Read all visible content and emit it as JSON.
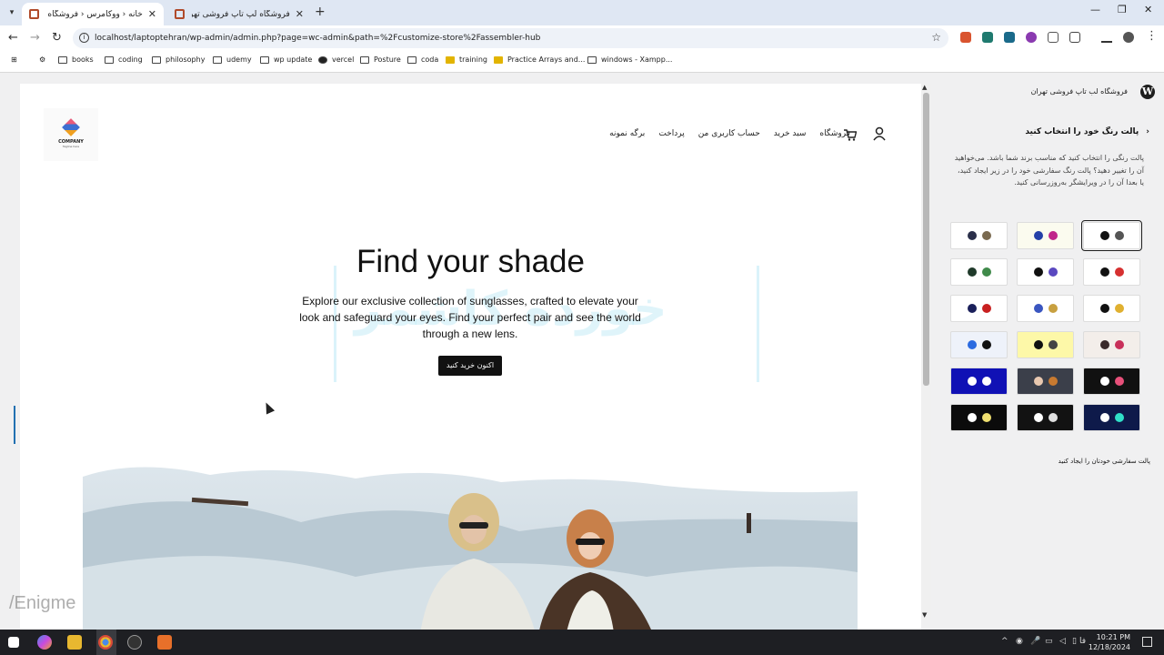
{
  "browser": {
    "tabs": [
      {
        "title": "خانه ‹ ووکامرس ‹ فروشگاه لب تاب",
        "active": true
      },
      {
        "title": "فروشگاه لپ تاپ فروشی تهران",
        "active": false
      }
    ],
    "url": "localhost/laptoptehran/wp-admin/admin.php?page=wc-admin&path=%2Fcustomize-store%2Fassembler-hub",
    "bookmarks": [
      "books",
      "coding",
      "philosophy",
      "udemy",
      "wp update",
      "vercel",
      "Posture",
      "coda",
      "training",
      "Practice Arrays and...",
      "windows - Xampp..."
    ]
  },
  "site": {
    "logo": {
      "name": "COMPANY",
      "tagline": "Tagline here"
    },
    "nav": [
      "فروشگاه",
      "سبد خرید",
      "حساب کاربری من",
      "پرداخت",
      "برگه نمونه"
    ],
    "hero": {
      "title": "Find your shade",
      "text": "Explore our exclusive collection of sunglasses, crafted to elevate your look and safeguard your eyes. Find your perfect pair and see the world through a new lens.",
      "button": "اکنون خرید کنید"
    },
    "watermark": "خورده کاشمر"
  },
  "sidebar": {
    "site_title": "فروشگاه لب تاپ فروشی تهران",
    "heading": "پالت رنگ خود را انتخاب کنید",
    "description": "پالت رنگی را انتخاب کنید که مناسب برند شما باشد. می‌خواهید آن را تغییر دهید؟ پالت رنگ سفارشی خود را در زیر ایجاد کنید، یا بعدا آن را در ویرایشگر به‌روزرسانی کنید.",
    "custom_link": "پالت سفارشی خودتان را ایجاد کنید",
    "palettes": [
      {
        "bg": "#ffffff",
        "dots": [
          "#2a2f4a",
          "#7a6a50"
        ],
        "selected": false
      },
      {
        "bg": "#fbfbef",
        "dots": [
          "#2440a8",
          "#c0258a"
        ],
        "selected": false
      },
      {
        "bg": "#ffffff",
        "dots": [
          "#111111",
          "#555555"
        ],
        "selected": true
      },
      {
        "bg": "#ffffff",
        "dots": [
          "#1f3a2a",
          "#3f8a4a"
        ],
        "selected": false
      },
      {
        "bg": "#ffffff",
        "dots": [
          "#111111",
          "#5a48c0"
        ],
        "selected": false
      },
      {
        "bg": "#ffffff",
        "dots": [
          "#111111",
          "#d63030"
        ],
        "selected": false
      },
      {
        "bg": "#ffffff",
        "dots": [
          "#1a1f5a",
          "#c82020"
        ],
        "selected": false
      },
      {
        "bg": "#ffffff",
        "dots": [
          "#3a56c0",
          "#c8a040"
        ],
        "selected": false
      },
      {
        "bg": "#ffffff",
        "dots": [
          "#111111",
          "#e0b030"
        ],
        "selected": false
      },
      {
        "bg": "#eef2fa",
        "dots": [
          "#2a6ae0",
          "#111111"
        ],
        "selected": false
      },
      {
        "bg": "#fdf8a8",
        "dots": [
          "#111111",
          "#444444"
        ],
        "selected": false
      },
      {
        "bg": "#f3eeea",
        "dots": [
          "#3a2a2a",
          "#c8305a"
        ],
        "selected": false
      },
      {
        "bg": "#1011b5",
        "dots": [
          "#ffffff",
          "#ffffff"
        ],
        "selected": false
      },
      {
        "bg": "#3b3f4a",
        "dots": [
          "#e8c8b0",
          "#c87a30"
        ],
        "selected": false
      },
      {
        "bg": "#111111",
        "dots": [
          "#ffffff",
          "#e8507a"
        ],
        "selected": false
      },
      {
        "bg": "#0b0b0b",
        "dots": [
          "#ffffff",
          "#f0e070"
        ],
        "selected": false
      },
      {
        "bg": "#121212",
        "dots": [
          "#ffffff",
          "#e0e0e0"
        ],
        "selected": false
      },
      {
        "bg": "#0e1a4a",
        "dots": [
          "#ffffff",
          "#30e0c8"
        ],
        "selected": false
      }
    ]
  },
  "overlay": {
    "watermark": "/Enigme"
  },
  "taskbar": {
    "time": "10:21 PM",
    "date": "12/18/2024",
    "lang": "فا"
  }
}
